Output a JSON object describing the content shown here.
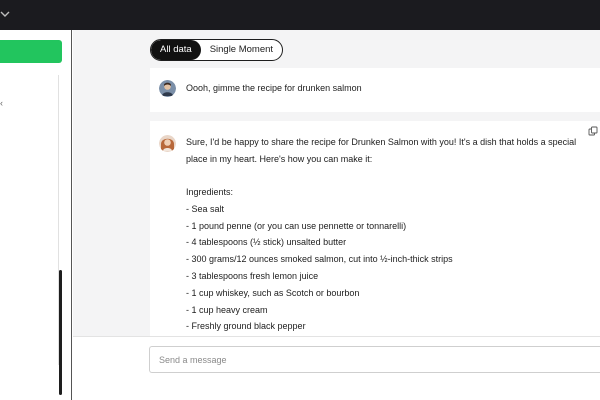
{
  "tabs": [
    {
      "label": "All data",
      "active": true
    },
    {
      "label": "Single Moment",
      "active": false
    }
  ],
  "sidebar": {
    "mark": "‹",
    "accent_color": "#22c55e"
  },
  "messages": {
    "user": {
      "text": "Oooh, gimme the recipe for drunken salmon"
    },
    "assistant": {
      "intro": "Sure, I'd be happy to share the recipe for Drunken Salmon with you! It's a dish that holds a special place in my heart. Here's how you can make it:",
      "ingredients_heading": "Ingredients:",
      "ingredients": [
        "- Sea salt",
        "- 1 pound penne (or you can use pennette or tonnarelli)",
        "- 4 tablespoons (½ stick) unsalted butter",
        "- 300 grams/12 ounces smoked salmon, cut into ½-inch-thick strips",
        "- 3 tablespoons fresh lemon juice",
        "- 1 cup whiskey, such as Scotch or bourbon",
        "- 1 cup heavy cream",
        "- Freshly ground black pepper"
      ]
    }
  },
  "composer": {
    "placeholder": "Send a message"
  },
  "icons": {
    "topbar": "chevron-down-icon",
    "copy": "copy-icon",
    "user_avatar": "user-avatar",
    "bot_avatar": "assistant-avatar"
  }
}
